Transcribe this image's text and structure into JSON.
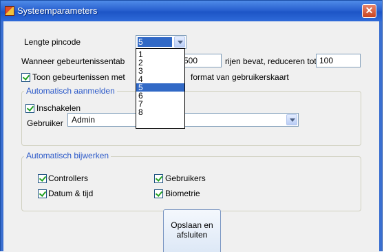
{
  "window": {
    "title": "Systeemparameters"
  },
  "pin": {
    "label": "Lengte pincode",
    "selected": "5",
    "options": [
      "1",
      "2",
      "3",
      "4",
      "5",
      "6",
      "7",
      "8"
    ],
    "selected_index": 4
  },
  "events": {
    "label_start": "Wanneer gebeurtenissentab",
    "max_value": "500",
    "label_reduce": "rijen bevat, reduceren tot",
    "reduce_value": "100",
    "show_label_start": "Toon gebeurtenissen met",
    "show_label_end": "format van gebruikerskaart"
  },
  "auto_login": {
    "title": "Automatisch aanmelden",
    "enable_label": "Inschakelen",
    "user_label": "Gebruiker",
    "user_value": "Admin"
  },
  "auto_update": {
    "title": "Automatisch bijwerken",
    "controllers": "Controllers",
    "users": "Gebruikers",
    "datetime": "Datum & tijd",
    "biometrics": "Biometrie"
  },
  "save_button": {
    "label_line1": "Opslaan en",
    "label_line2": "afsluiten"
  },
  "colors": {
    "titlebar": "#2a62d0",
    "selection": "#3169c6",
    "group_title": "#2a58c8"
  }
}
